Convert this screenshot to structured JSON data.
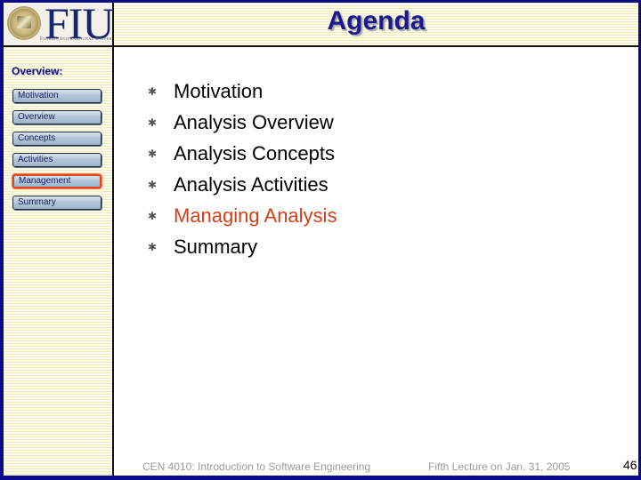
{
  "header": {
    "logo_text": "FIU",
    "logo_subtitle": "Florida International University",
    "title": "Agenda"
  },
  "sidebar": {
    "heading": "Overview:",
    "items": [
      {
        "label": "Motivation",
        "active": false
      },
      {
        "label": "Overview",
        "active": false
      },
      {
        "label": "Concepts",
        "active": false
      },
      {
        "label": "Activities",
        "active": false
      },
      {
        "label": "Management",
        "active": true
      },
      {
        "label": "Summary",
        "active": false
      }
    ]
  },
  "main": {
    "bullet_icon": "asterisk-bullet-icon",
    "bullet_glyph": "✱",
    "items": [
      {
        "label": "Motivation",
        "current": false
      },
      {
        "label": "Analysis Overview",
        "current": false
      },
      {
        "label": "Analysis Concepts",
        "current": false
      },
      {
        "label": "Analysis Activities",
        "current": false
      },
      {
        "label": "Managing Analysis",
        "current": true
      },
      {
        "label": "Summary",
        "current": false
      }
    ],
    "current_color": "#d2401a"
  },
  "footer": {
    "course": "CEN 4010: Introduction to Software Engineering",
    "lecture": "Fifth Lecture on Jan. 31, 2005",
    "page_number": "46"
  },
  "colors": {
    "frame": "#0a0a8a",
    "title": "#1a1a8c",
    "active_outline": "#e0451f"
  }
}
